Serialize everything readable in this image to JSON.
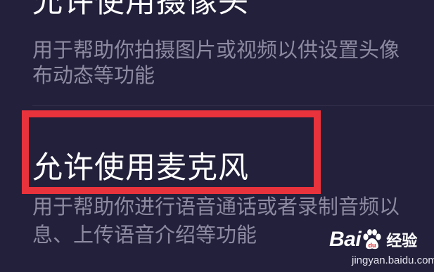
{
  "permissions": [
    {
      "title": "允许使用摄像头",
      "description_lines": [
        "用于帮助你拍摄图片或视频以供设置头像",
        "布动态等功能"
      ]
    },
    {
      "title": "允许使用麦克风",
      "description_lines": [
        "用于帮助你进行语音通话或者录制音频以",
        "息、上传语音介绍等功能"
      ]
    }
  ],
  "highlight_color": "#e8323c",
  "background_color": "#22203a",
  "watermark": {
    "brand_left": "Bai",
    "brand_right": "du",
    "paw_icon": "baidu-paw-icon",
    "product": "经验",
    "url": "jingyan.baidu.com"
  }
}
